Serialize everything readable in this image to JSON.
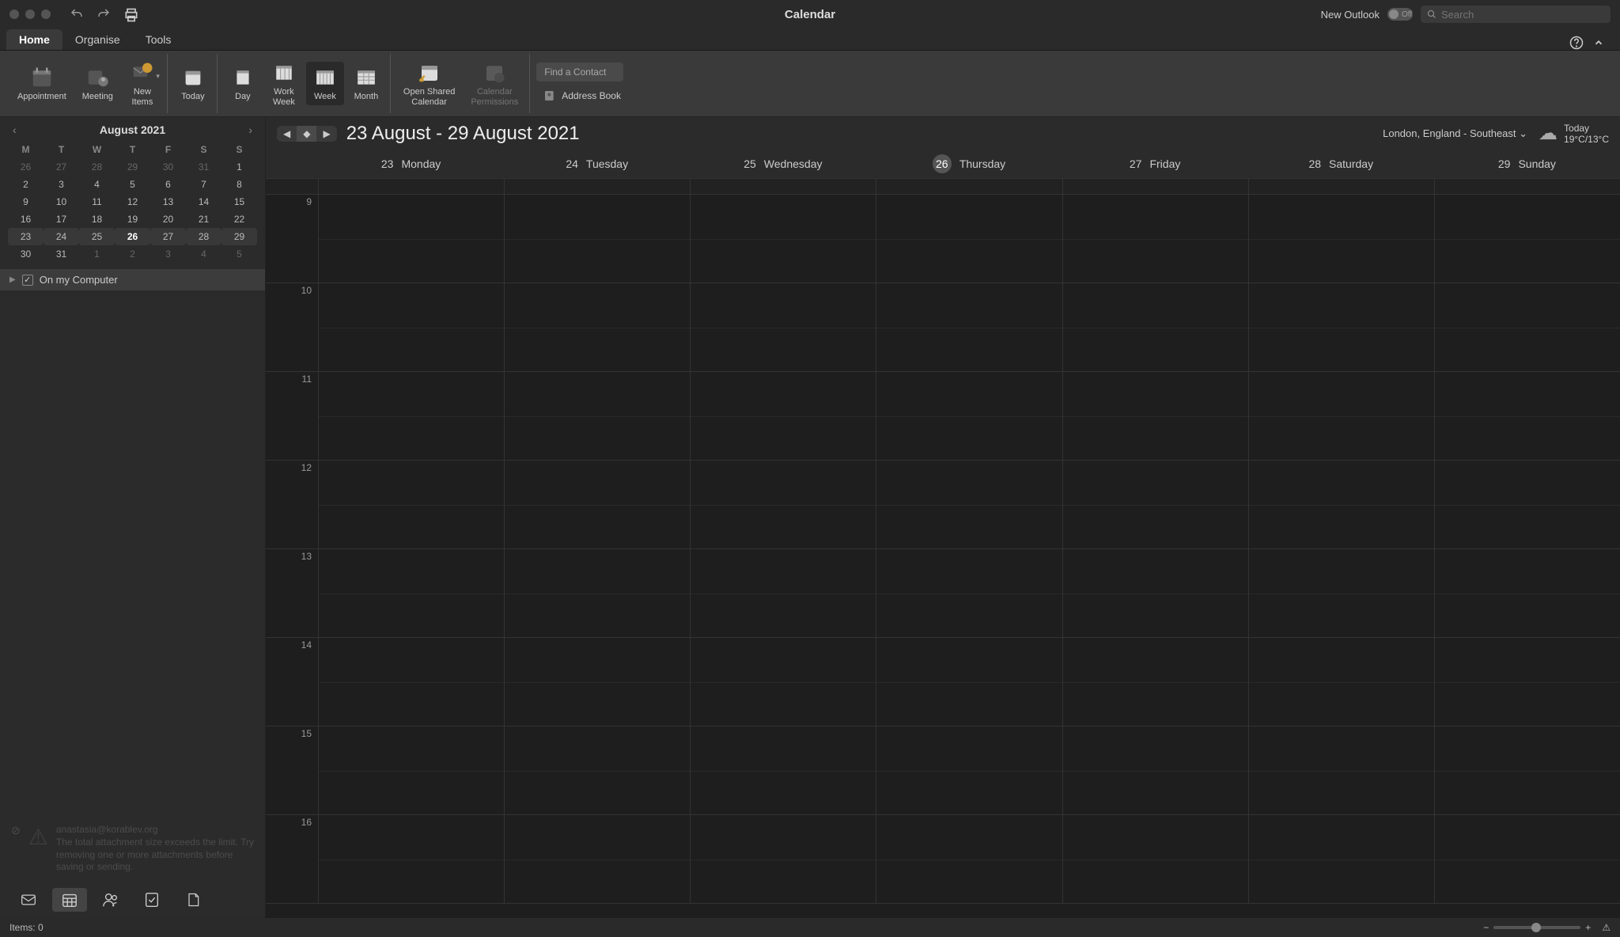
{
  "titlebar": {
    "title": "Calendar",
    "new_outlook": "New Outlook",
    "toggle_label": "Off",
    "search_placeholder": "Search"
  },
  "tabs": {
    "home": "Home",
    "organise": "Organise",
    "tools": "Tools"
  },
  "ribbon": {
    "appointment": "Appointment",
    "meeting": "Meeting",
    "new_items": "New\nItems",
    "today": "Today",
    "day": "Day",
    "work_week": "Work\nWeek",
    "week": "Week",
    "month": "Month",
    "open_shared": "Open Shared\nCalendar",
    "permissions": "Calendar\nPermissions",
    "find_contact": "Find a Contact",
    "address_book": "Address Book"
  },
  "minical": {
    "title": "August 2021",
    "dow": [
      "M",
      "T",
      "W",
      "T",
      "F",
      "S",
      "S"
    ],
    "weeks": [
      [
        {
          "d": "26",
          "cls": "prev"
        },
        {
          "d": "27",
          "cls": "prev"
        },
        {
          "d": "28",
          "cls": "prev"
        },
        {
          "d": "29",
          "cls": "prev"
        },
        {
          "d": "30",
          "cls": "prev"
        },
        {
          "d": "31",
          "cls": "prev"
        },
        {
          "d": "1"
        }
      ],
      [
        {
          "d": "2"
        },
        {
          "d": "3"
        },
        {
          "d": "4"
        },
        {
          "d": "5"
        },
        {
          "d": "6"
        },
        {
          "d": "7"
        },
        {
          "d": "8"
        }
      ],
      [
        {
          "d": "9"
        },
        {
          "d": "10"
        },
        {
          "d": "11"
        },
        {
          "d": "12"
        },
        {
          "d": "13"
        },
        {
          "d": "14"
        },
        {
          "d": "15"
        }
      ],
      [
        {
          "d": "16"
        },
        {
          "d": "17"
        },
        {
          "d": "18"
        },
        {
          "d": "19"
        },
        {
          "d": "20"
        },
        {
          "d": "21"
        },
        {
          "d": "22"
        }
      ],
      [
        {
          "d": "23",
          "cls": "wk"
        },
        {
          "d": "24",
          "cls": "wk"
        },
        {
          "d": "25",
          "cls": "wk"
        },
        {
          "d": "26",
          "cls": "wk today"
        },
        {
          "d": "27",
          "cls": "wk"
        },
        {
          "d": "28",
          "cls": "wk"
        },
        {
          "d": "29",
          "cls": "wk"
        }
      ],
      [
        {
          "d": "30"
        },
        {
          "d": "31"
        },
        {
          "d": "1",
          "cls": "next"
        },
        {
          "d": "2",
          "cls": "next"
        },
        {
          "d": "3",
          "cls": "next"
        },
        {
          "d": "4",
          "cls": "next"
        },
        {
          "d": "5",
          "cls": "next"
        }
      ]
    ]
  },
  "calendars": {
    "on_my_computer": "On my Computer"
  },
  "notice": {
    "email": "anastasia@korablev.org",
    "message": "The total attachment size exceeds the limit. Try removing one or more attachments before saving or sending."
  },
  "calhead": {
    "range": "23 August - 29 August 2021",
    "location": "London, England - Southeast ⌄",
    "weather_label": "Today",
    "weather_temp": "19°C/13°C"
  },
  "days": [
    {
      "num": "23",
      "name": "Monday"
    },
    {
      "num": "24",
      "name": "Tuesday"
    },
    {
      "num": "25",
      "name": "Wednesday"
    },
    {
      "num": "26",
      "name": "Thursday",
      "today": true
    },
    {
      "num": "27",
      "name": "Friday"
    },
    {
      "num": "28",
      "name": "Saturday"
    },
    {
      "num": "29",
      "name": "Sunday"
    }
  ],
  "hours": [
    "9",
    "10",
    "11",
    "12",
    "13",
    "14",
    "15",
    "16"
  ],
  "status": {
    "items": "Items: 0"
  }
}
